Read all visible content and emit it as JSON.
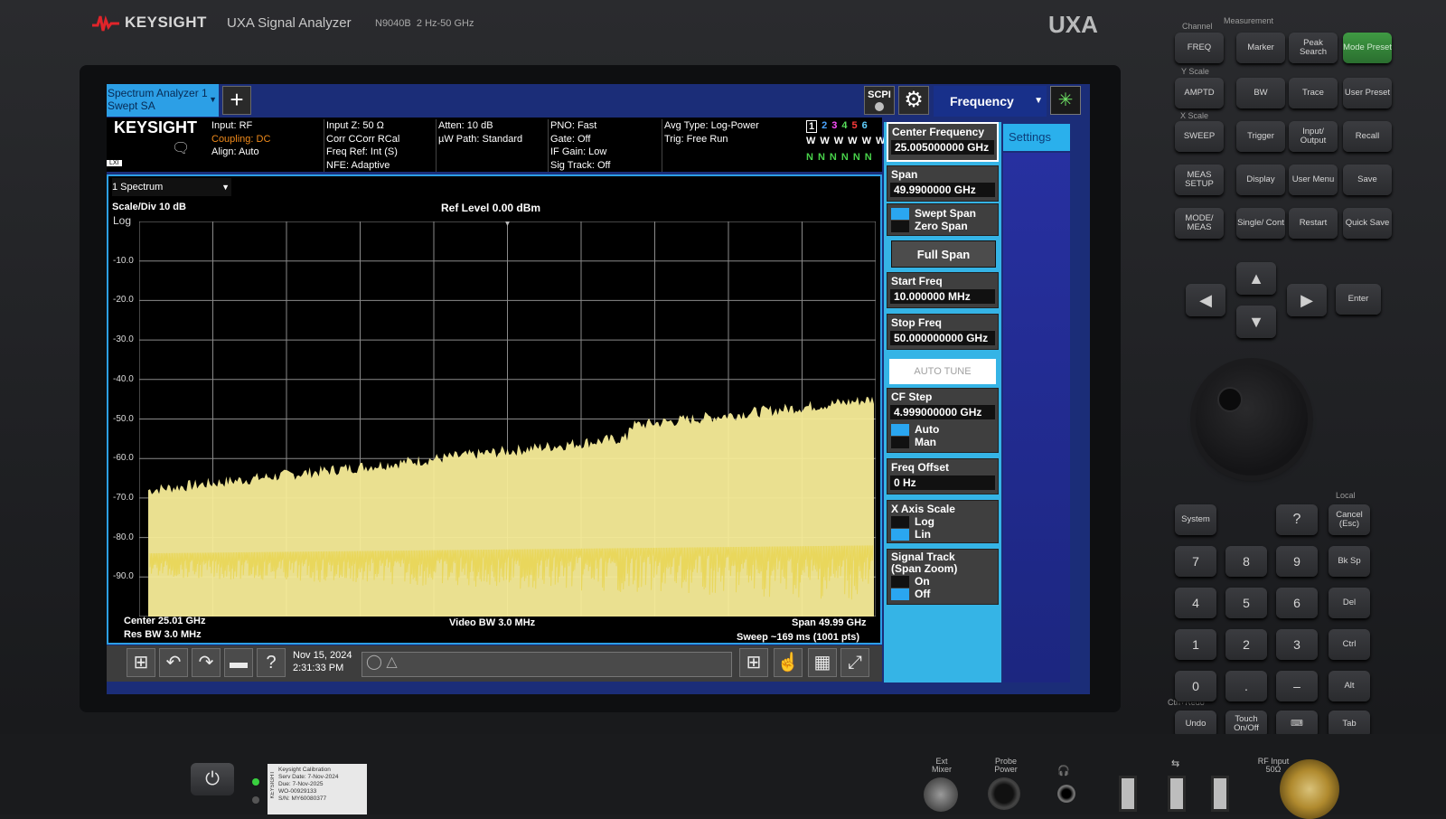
{
  "instrument": {
    "brand": "KEYSIGHT",
    "model": "UXA Signal Analyzer",
    "model_number": "N9040B",
    "freq_range": "2 Hz-50 GHz",
    "badge": "UXA"
  },
  "toolbar": {
    "active_tab_line1": "Spectrum Analyzer 1",
    "active_tab_line2": "Swept SA",
    "add_label": "+",
    "scpi_label": "SCPI",
    "menu_title": "Frequency"
  },
  "status": {
    "logo": "KEYSIGHT",
    "lxi": "LXI",
    "col1": [
      "Input: RF",
      "Coupling: DC",
      "Align: Auto"
    ],
    "col2": [
      "Input Z: 50 Ω",
      "Corr CCorr RCal",
      "Freq Ref: Int (S)",
      "NFE: Adaptive"
    ],
    "col3": [
      "Atten: 10 dB",
      "µW Path: Standard"
    ],
    "col4": [
      "PNO: Fast",
      "Gate: Off",
      "IF Gain: Low",
      "Sig Track: Off"
    ],
    "col5": [
      "Avg Type: Log-Power",
      "Trig: Free Run"
    ],
    "trace_numbers": [
      "1",
      "2",
      "3",
      "4",
      "5",
      "6"
    ],
    "trace_colors": [
      "#ffffff",
      "#4aa3ff",
      "#ff4fff",
      "#58e05c",
      "#ff3b3b",
      "#5fd0ff"
    ],
    "trace_types": [
      "W",
      "W",
      "W",
      "W",
      "W",
      "W"
    ],
    "trace_detectors": [
      "N",
      "N",
      "N",
      "N",
      "N",
      "N"
    ]
  },
  "graph": {
    "window_title": "1 Spectrum",
    "scale_div": "Scale/Div 10 dB",
    "log_label": "Log",
    "ref_level": "Ref Level 0.00 dBm",
    "y_ticks": [
      "-10.0",
      "-20.0",
      "-30.0",
      "-40.0",
      "-50.0",
      "-60.0",
      "-70.0",
      "-80.0",
      "-90.0"
    ],
    "center": "Center 25.01 GHz",
    "res_bw": "Res BW 3.0 MHz",
    "video_bw": "Video BW 3.0 MHz",
    "span": "Span 49.99 GHz",
    "sweep": "Sweep ~169 ms (1001 pts)",
    "trace_color": "#f2e37a"
  },
  "taskbar": {
    "date": "Nov 15, 2024",
    "time": "2:31:33 PM"
  },
  "softkeys": {
    "settings_tab": "Settings",
    "center_freq_label": "Center Frequency",
    "center_freq_value": "25.005000000 GHz",
    "span_label": "Span",
    "span_value": "49.9900000 GHz",
    "swept_span": "Swept Span",
    "zero_span": "Zero Span",
    "full_span": "Full Span",
    "start_freq_label": "Start Freq",
    "start_freq_value": "10.000000 MHz",
    "stop_freq_label": "Stop Freq",
    "stop_freq_value": "50.000000000 GHz",
    "auto_tune": "AUTO TUNE",
    "cf_step_label": "CF Step",
    "cf_step_value": "4.999000000 GHz",
    "auto": "Auto",
    "man": "Man",
    "freq_offset_label": "Freq Offset",
    "freq_offset_value": "0 Hz",
    "x_axis_label": "X Axis Scale",
    "log": "Log",
    "lin": "Lin",
    "signal_track_label": "Signal Track",
    "signal_track_sub": "(Span Zoom)",
    "on": "On",
    "off": "Off"
  },
  "front_panel": {
    "channel": "Channel",
    "measurement": "Measurement",
    "y_scale": "Y Scale",
    "x_scale": "X Scale",
    "local": "Local",
    "ctrl_redo": "Ctrl+Redo",
    "keys": {
      "freq": "FREQ",
      "marker": "Marker",
      "peak_search": "Peak Search",
      "mode_preset": "Mode Preset",
      "ampt": "AMPTD",
      "bw": "BW",
      "trace": "Trace",
      "user_preset": "User Preset",
      "sweep": "SWEEP",
      "trigger": "Trigger",
      "input_output": "Input/ Output",
      "recall": "Recall",
      "meas_setup": "MEAS SETUP",
      "display": "Display",
      "user_menu": "User Menu",
      "save": "Save",
      "mode_meas": "MODE/ MEAS",
      "single_cont": "Single/ Cont",
      "restart": "Restart",
      "quick_save": "Quick Save",
      "enter": "Enter",
      "system": "System",
      "help": "?",
      "cancel": "Cancel (Esc)",
      "k7": "7",
      "k8": "8",
      "k9": "9",
      "bksp": "Bk Sp",
      "k4": "4",
      "k5": "5",
      "k6": "6",
      "del": "Del",
      "k1": "1",
      "k2": "2",
      "k3": "3",
      "ctrl": "Ctrl",
      "k0": "0",
      "dot": ".",
      "minus": "–",
      "alt": "Alt",
      "undo": "Undo",
      "touch": "Touch On/Off",
      "tab": "Tab"
    }
  },
  "bottom": {
    "calibration_lines": [
      "Keysight Calibration",
      "Serv Date:  7-Nov-2024",
      "Due:           7-Nov-2025",
      "WO-00929133",
      "S/N: MY60080377"
    ],
    "cal_side": "KEYSIGHT",
    "ext_mixer": "Ext Mixer",
    "probe_power": "Probe Power",
    "rf_input": "RF Input 50Ω"
  }
}
